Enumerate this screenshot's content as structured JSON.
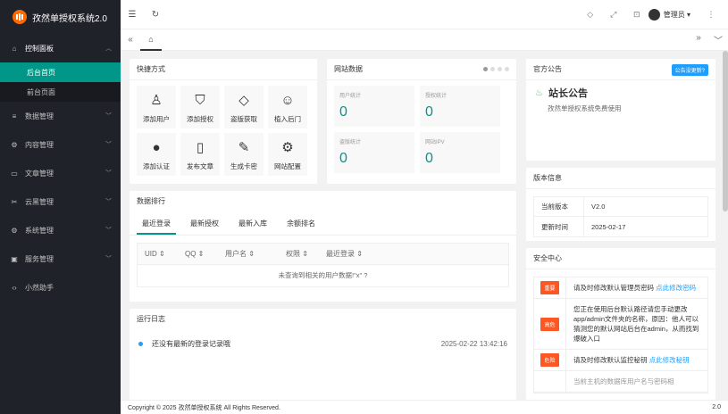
{
  "app": {
    "title": "孜然单授权系统2.0"
  },
  "sidebar": {
    "items": [
      {
        "label": "控制面板",
        "icon": "home-icon",
        "glyph": "⌂",
        "expanded": true
      },
      {
        "label": "数据管理",
        "icon": "database-icon",
        "glyph": "≡"
      },
      {
        "label": "内容管理",
        "icon": "settings-icon",
        "glyph": "⚙"
      },
      {
        "label": "文章管理",
        "icon": "book-icon",
        "glyph": "▭"
      },
      {
        "label": "云黑管理",
        "icon": "unlink-icon",
        "glyph": "✂"
      },
      {
        "label": "系统管理",
        "icon": "gear-icon",
        "glyph": "⚙"
      },
      {
        "label": "服务管理",
        "icon": "server-icon",
        "glyph": "▣"
      },
      {
        "label": "小然助手",
        "icon": "code-icon",
        "glyph": "‹›"
      }
    ],
    "sub": [
      "后台首页",
      "前台页面"
    ]
  },
  "header": {
    "user": "管理员"
  },
  "quick": {
    "title": "快捷方式",
    "items": [
      {
        "label": "添加用户",
        "glyph": "♙"
      },
      {
        "label": "添加授权",
        "glyph": "⛉"
      },
      {
        "label": "盗版获取",
        "glyph": "◇"
      },
      {
        "label": "植入后门",
        "glyph": "☺"
      },
      {
        "label": "添加认证",
        "glyph": "●"
      },
      {
        "label": "发布文章",
        "glyph": "▯"
      },
      {
        "label": "生成卡密",
        "glyph": "✎"
      },
      {
        "label": "网站配置",
        "glyph": "⚙"
      }
    ]
  },
  "stats": {
    "title": "网站数据",
    "items": [
      {
        "label": "用户统计",
        "value": "0"
      },
      {
        "label": "授权统计",
        "value": "0"
      },
      {
        "label": "盗版统计",
        "value": "0"
      },
      {
        "label": "网站IPV",
        "value": "0"
      }
    ]
  },
  "rank": {
    "title": "数据排行",
    "tabs": [
      "最近登录",
      "最新授权",
      "最新入库",
      "余额排名"
    ],
    "columns": [
      "UID",
      "QQ",
      "用户名",
      "权限",
      "最近登录"
    ],
    "empty": "未查询到相关的用户数据!\"x\" ?"
  },
  "log": {
    "title": "运行日志",
    "items": [
      {
        "text": "还没有最新的登录记录哦",
        "time": "2025-02-22 13:42:16"
      }
    ]
  },
  "notice": {
    "title": "官方公告",
    "badge": "公告没更新?",
    "heading": "站长公告",
    "text": "孜然单授权系统免费使用"
  },
  "version": {
    "title": "版本信息",
    "rows": [
      {
        "k": "当前版本",
        "v": "V2.0"
      },
      {
        "k": "更新时间",
        "v": "2025-02-17"
      }
    ]
  },
  "security": {
    "title": "安全中心",
    "rows": [
      {
        "level": "重要",
        "color": "#ff5722",
        "text": "请及时修改默认管理员密码 ",
        "link": "点此修改密码"
      },
      {
        "level": "高危",
        "color": "#ff5722",
        "text": "您正在使用后台默认路径请您手动更改app/admin文件夹的名称，原因：他人可以猜测您的默认网站后台在admin，从而找到爆破入口",
        "link": ""
      },
      {
        "level": "危险",
        "color": "#ff5722",
        "text": "请及时修改默认监控秘钥 ",
        "link": "点此修改秘钥"
      },
      {
        "level": "",
        "color": "#ffffff",
        "text": "当前主机的数据库用户名与密码相",
        "link": ""
      }
    ]
  },
  "footer": {
    "copyright": "Copyright © 2025 孜然单授权系统 All Rights Reserved.",
    "version": "2.0"
  }
}
